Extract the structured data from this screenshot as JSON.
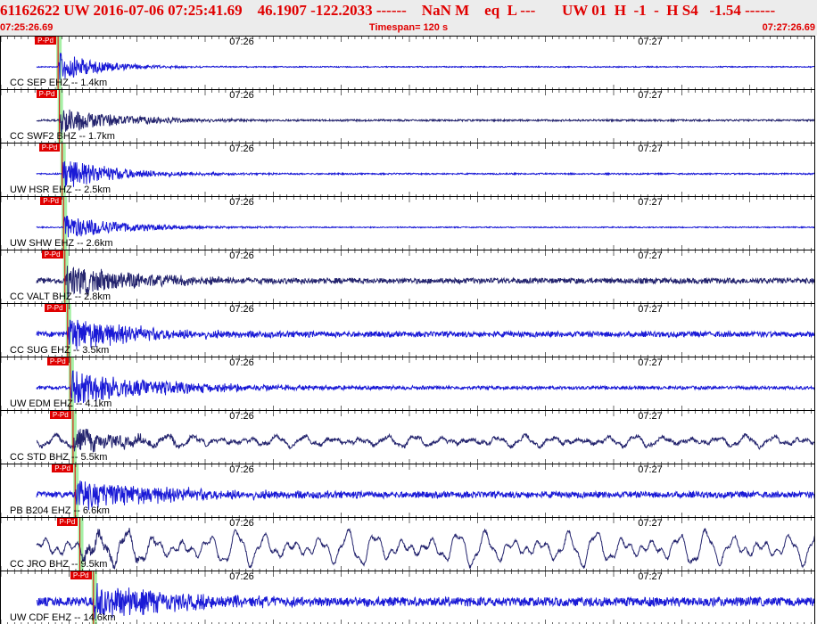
{
  "header": {
    "title": "61162622 UW 2016-07-06 07:25:41.69    46.1907 -122.2033 ------    NaN M    eq  L ---       UW 01  H  -1  -  H S4   -1.54 ------",
    "start_time": "07:25:26.69",
    "timespan": "Timespan= 120 s",
    "end_time": "07:27:26.69"
  },
  "time_ticks": [
    {
      "label": "07:26",
      "seconds": 33.31
    },
    {
      "label": "07:27",
      "seconds": 93.31
    }
  ],
  "colors": {
    "trace_blue": "#1a1ad6",
    "trace_navy": "#24246e",
    "pick_red": "#e00000",
    "pick_window": "#a6f0a6",
    "title_red": "#e00000"
  },
  "traces": [
    {
      "label": "CC SEP EHZ -- 1.4km",
      "pick_label": "P-Pd",
      "pick_s": 8.4,
      "color": "#1a1ad6",
      "amp": 17,
      "noise": 0.6,
      "lowfreq": 0,
      "decay": 6
    },
    {
      "label": "CC SWF2 BHZ -- 1.7km",
      "pick_label": "P-Pd",
      "pick_s": 8.6,
      "color": "#24246e",
      "amp": 15,
      "noise": 1.0,
      "lowfreq": 0,
      "decay": 9
    },
    {
      "label": "UW HSR EHZ -- 2.5km",
      "pick_label": "P-Pd",
      "pick_s": 9.0,
      "color": "#1a1ad6",
      "amp": 18,
      "noise": 0.8,
      "lowfreq": 0,
      "decay": 8
    },
    {
      "label": "UW SHW EHZ -- 2.6km",
      "pick_label": "P-Pd",
      "pick_s": 9.2,
      "color": "#1a1ad6",
      "amp": 14,
      "noise": 0.6,
      "lowfreq": 0,
      "decay": 9
    },
    {
      "label": "CC VALT BHZ -- 2.8km",
      "pick_label": "P-Pd",
      "pick_s": 9.4,
      "color": "#24246e",
      "amp": 19,
      "noise": 3.0,
      "lowfreq": 0,
      "decay": 11
    },
    {
      "label": "CC SUG EHZ -- 3.5km",
      "pick_label": "P-Pd",
      "pick_s": 9.8,
      "color": "#1a1ad6",
      "amp": 19,
      "noise": 3.0,
      "lowfreq": 0,
      "decay": 11
    },
    {
      "label": "UW EDM EHZ -- 4.1km",
      "pick_label": "P-Pd",
      "pick_s": 10.2,
      "color": "#1a1ad6",
      "amp": 19,
      "noise": 1.8,
      "lowfreq": 0,
      "decay": 14
    },
    {
      "label": "CC STD BHZ -- 5.5km",
      "pick_label": "P-Pd",
      "pick_s": 10.6,
      "color": "#24246e",
      "amp": 12,
      "noise": 2.0,
      "lowfreq": 6,
      "decay": 9
    },
    {
      "label": "PB B204 EHZ -- 6.6km",
      "pick_label": "P-Pd",
      "pick_s": 10.9,
      "color": "#1a1ad6",
      "amp": 17,
      "noise": 3.4,
      "lowfreq": 0,
      "decay": 15
    },
    {
      "label": "CC JRO BHZ -- 9.5km",
      "pick_label": "P-Pd",
      "pick_s": 11.6,
      "color": "#24246e",
      "amp": 8,
      "noise": 1.5,
      "lowfreq": 18,
      "decay": 8
    },
    {
      "label": "UW CDF EHZ -- 14.6km",
      "pick_label": "P-Pd",
      "pick_s": 13.6,
      "color": "#1a1ad6",
      "amp": 20,
      "noise": 5.0,
      "lowfreq": 0,
      "decay": 12
    }
  ]
}
